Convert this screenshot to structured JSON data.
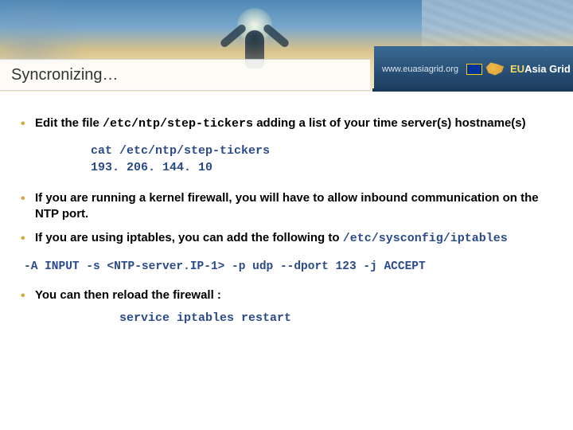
{
  "header": {
    "title": "Syncronizing…",
    "site_url": "www.euasiagrid.org",
    "logo_eu": "EU",
    "logo_rest": "Asia Grid"
  },
  "bullets": {
    "b1_pre": "Edit the file ",
    "b1_code": "/etc/ntp/step-tickers",
    "b1_post": " adding a list of your time server(s) hostname(s)",
    "code1_l1": "cat /etc/ntp/step-tickers",
    "code1_l2": "193. 206. 144. 10",
    "b2": "If you are running a kernel firewall, you will have to allow inbound communication on the NTP port.",
    "b3_pre": "If you are using iptables, you can add the following to ",
    "b3_code": "/etc/sysconfig/iptables",
    "cmd": "-A INPUT -s <NTP-server.IP-1> -p udp --dport 123 -j ACCEPT",
    "b4": "You can then reload the firewall :",
    "cmd2": "service iptables restart"
  }
}
